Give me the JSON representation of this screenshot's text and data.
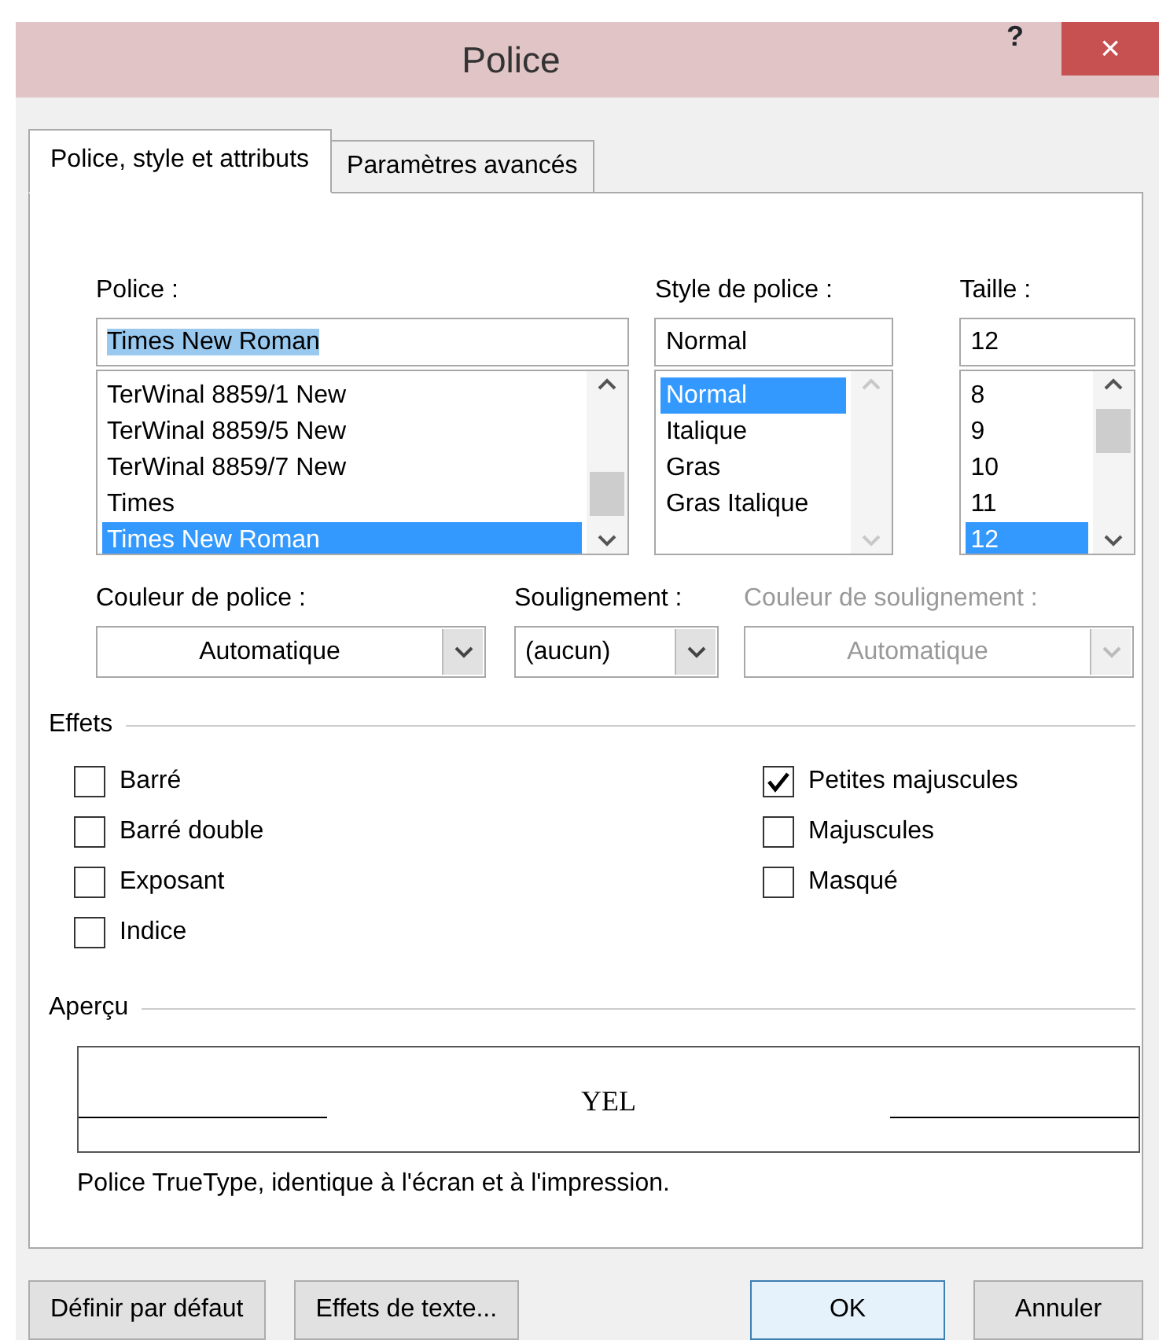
{
  "window": {
    "title": "Police",
    "help_button": "?",
    "close_button": "×"
  },
  "tabs": [
    {
      "label": "Police, style et attributs",
      "selected": true
    },
    {
      "label": "Paramètres avancés",
      "selected": false
    }
  ],
  "lists": [
    {
      "label": "Police :",
      "value": "Times New Roman",
      "text_selected": true,
      "scrollbar_disabled": false,
      "items": [
        {
          "label": "TerWinal 8859/1 New",
          "selected": false
        },
        {
          "label": "TerWinal 8859/5 New",
          "selected": false
        },
        {
          "label": "TerWinal 8859/7 New",
          "selected": false
        },
        {
          "label": "Times",
          "selected": false
        },
        {
          "label": "Times New Roman",
          "selected": true
        }
      ]
    },
    {
      "label": "Style de police :",
      "value": "Normal",
      "text_selected": false,
      "scrollbar_disabled": true,
      "items": [
        {
          "label": "Normal",
          "selected": true
        },
        {
          "label": "Italique",
          "selected": false
        },
        {
          "label": "Gras",
          "selected": false
        },
        {
          "label": "Gras Italique",
          "selected": false
        }
      ]
    },
    {
      "label": "Taille :",
      "value": "12",
      "text_selected": false,
      "scrollbar_disabled": false,
      "items": [
        {
          "label": "8",
          "selected": false
        },
        {
          "label": "9",
          "selected": false
        },
        {
          "label": "10",
          "selected": false
        },
        {
          "label": "11",
          "selected": false
        },
        {
          "label": "12",
          "selected": true
        }
      ]
    }
  ],
  "dropdowns": [
    {
      "label": "Couleur de police :",
      "value": "Automatique",
      "disabled": false
    },
    {
      "label": "Soulignement :",
      "value": "(aucun)",
      "disabled": false
    },
    {
      "label": "Couleur de soulignement :",
      "value": "Automatique",
      "disabled": true
    }
  ],
  "effects": {
    "title": "Effets",
    "left": [
      {
        "label": "Barré",
        "checked": false
      },
      {
        "label": "Barré double",
        "checked": false
      },
      {
        "label": "Exposant",
        "checked": false
      },
      {
        "label": "Indice",
        "checked": false
      }
    ],
    "right": [
      {
        "label": "Petites majuscules",
        "checked": true
      },
      {
        "label": "Majuscules",
        "checked": false
      },
      {
        "label": "Masqué",
        "checked": false
      }
    ]
  },
  "preview": {
    "title": "Aperçu",
    "sample": "YEL",
    "note": "Police TrueType, identique à l'écran et à l'impression."
  },
  "buttons": [
    {
      "label": "Définir par défaut",
      "default": false
    },
    {
      "label": "Effets de texte...",
      "default": false
    },
    {
      "label": "OK",
      "default": true
    },
    {
      "label": "Annuler",
      "default": false
    }
  ]
}
